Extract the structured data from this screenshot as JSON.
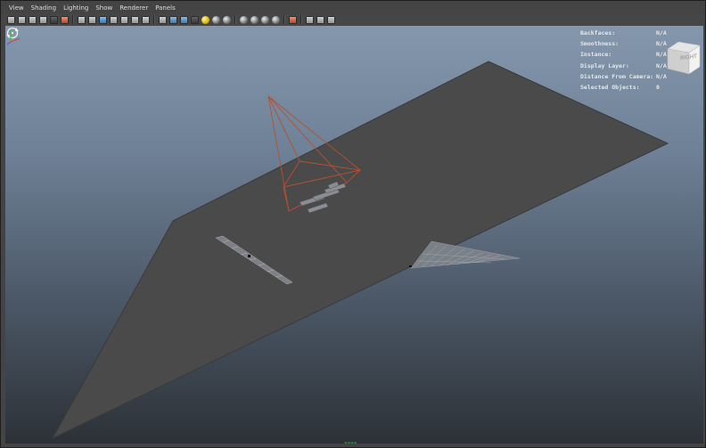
{
  "menu": {
    "items": [
      {
        "label": "View"
      },
      {
        "label": "Shading"
      },
      {
        "label": "Lighting"
      },
      {
        "label": "Show"
      },
      {
        "label": "Renderer"
      },
      {
        "label": "Panels"
      }
    ]
  },
  "toolbar": {
    "icons": [
      "select-camera-icon",
      "camera-attributes-icon",
      "bookmarks-icon",
      "image-plane-icon",
      "two-d-pan-zoom-icon",
      "grease-pencil-icon",
      "grid-icon",
      "film-gate-icon",
      "resolution-gate-icon",
      "gate-mask-icon",
      "field-chart-icon",
      "safe-action-icon",
      "safe-title-icon",
      "wireframe-icon",
      "smooth-shade-icon",
      "wireframe-on-shaded-icon",
      "textured-icon",
      "use-all-lights-icon",
      "shadows-icon",
      "screen-space-ao-icon",
      "motion-blur-icon",
      "multisample-aa-icon",
      "depth-of-field-icon",
      "x-ray-icon",
      "isolate-select-icon",
      "xray-joints-icon",
      "xray-active-components-icon"
    ]
  },
  "hud": {
    "rows": [
      {
        "label": "Backfaces:",
        "value": "N/A"
      },
      {
        "label": "Smoothness:",
        "value": "N/A"
      },
      {
        "label": "Instance:",
        "value": "N/A"
      },
      {
        "label": "Display Layer:",
        "value": "N/A"
      },
      {
        "label": "Distance From Camera:",
        "value": "N/A"
      },
      {
        "label": "Selected Objects:",
        "value": "0"
      }
    ]
  },
  "viewcube": {
    "label": "RIGHT"
  },
  "colors": {
    "plane": "#4a4a4a",
    "camera_wire": "#b5502e",
    "hud_text": "#e8e8e8",
    "viewport_top": "#8497ad",
    "viewport_bottom": "#2c3137"
  }
}
